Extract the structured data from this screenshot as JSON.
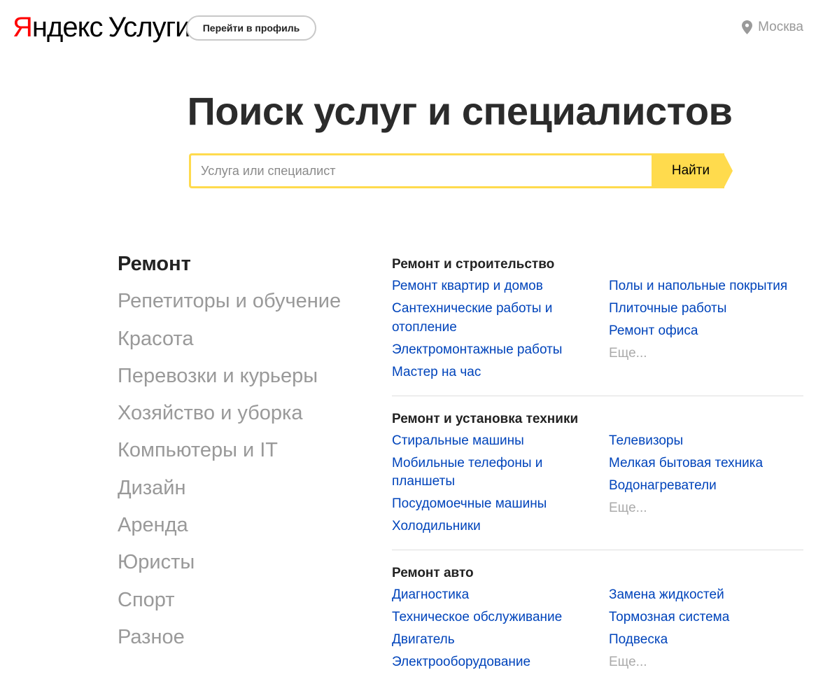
{
  "header": {
    "logo_ya": "Я",
    "logo_rest": "ндекс",
    "logo_service": "Услуги",
    "profile_button": "Перейти в профиль",
    "city": "Москва",
    "pin_icon": "location-pin-icon"
  },
  "hero": {
    "title": "Поиск услуг и специалистов",
    "search_placeholder": "Услуга или специалист",
    "search_value": "",
    "search_button": "Найти"
  },
  "colors": {
    "brand_red": "#ff0000",
    "accent_yellow": "#ffdb4d",
    "link_blue": "#0044bb",
    "muted_gray": "#999999"
  },
  "categories": [
    {
      "label": "Ремонт",
      "active": true
    },
    {
      "label": "Репетиторы и обучение",
      "active": false
    },
    {
      "label": "Красота",
      "active": false
    },
    {
      "label": "Перевозки и курьеры",
      "active": false
    },
    {
      "label": "Хозяйство и уборка",
      "active": false
    },
    {
      "label": "Компьютеры и IT",
      "active": false
    },
    {
      "label": "Дизайн",
      "active": false
    },
    {
      "label": "Аренда",
      "active": false
    },
    {
      "label": "Юристы",
      "active": false
    },
    {
      "label": "Спорт",
      "active": false
    },
    {
      "label": "Разное",
      "active": false
    }
  ],
  "groups": [
    {
      "title": "Ремонт и строительство",
      "left": [
        "Ремонт квартир и домов",
        "Сантехнические работы и отопление",
        "Электромонтажные работы",
        "Мастер на час"
      ],
      "right": [
        "Полы и напольные покрытия",
        "Плиточные работы",
        "Ремонт офиса",
        "Еще..."
      ]
    },
    {
      "title": "Ремонт и установка техники",
      "left": [
        "Стиральные машины",
        "Мобильные телефоны и планшеты",
        "Посудомоечные машины",
        "Холодильники"
      ],
      "right": [
        "Телевизоры",
        "Мелкая бытовая техника",
        "Водонагреватели",
        "Еще..."
      ]
    },
    {
      "title": "Ремонт авто",
      "left": [
        "Диагностика",
        "Техническое обслуживание",
        "Двигатель",
        "Электрооборудование"
      ],
      "right": [
        "Замена жидкостей",
        "Тормозная система",
        "Подвеска",
        "Еще..."
      ]
    }
  ]
}
